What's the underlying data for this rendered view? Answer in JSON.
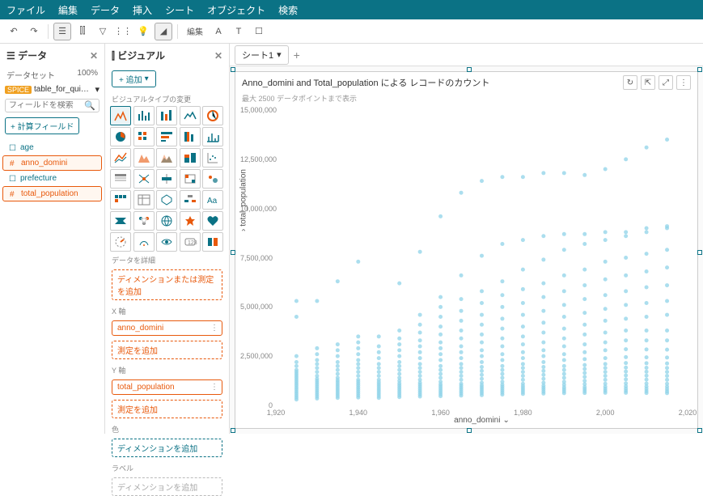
{
  "menu": {
    "items": [
      "ファイル",
      "編集",
      "データ",
      "挿入",
      "シート",
      "オブジェクト",
      "検索"
    ]
  },
  "toolbar": {
    "icons": [
      "undo",
      "redo",
      "autosave",
      "chart",
      "filter",
      "params",
      "insight",
      "highlight",
      "edit",
      "text",
      "ruler"
    ]
  },
  "data_panel": {
    "title": "データ",
    "subtitle": "データセット",
    "pct": "100%",
    "spice": "SPICE",
    "dataset": "table_for_quicksig...",
    "search_placeholder": "フィールドを検索",
    "calc_btn": "+ 計算フィールド",
    "fields": [
      {
        "name": "age",
        "type": "dim",
        "selected": false
      },
      {
        "name": "anno_domini",
        "type": "meas",
        "selected": true
      },
      {
        "name": "prefecture",
        "type": "dim",
        "selected": false
      },
      {
        "name": "total_population",
        "type": "meas",
        "selected": true
      }
    ]
  },
  "visual_panel": {
    "title": "ビジュアル",
    "add_btn": "+ 追加",
    "type_label": "ビジュアルタイプの変更",
    "types_count": 35,
    "selected_type": 0,
    "drill_label": "データを詳細",
    "drill_well": "ディメンションまたは測定を追加",
    "x_label": "X 軸",
    "x_well": "anno_domini",
    "x_add": "測定を追加",
    "y_label": "Y 軸",
    "y_well": "total_population",
    "y_add": "測定を追加",
    "color_label": "色",
    "color_well": "ディメンションを追加",
    "label_label": "ラベル",
    "label_well": "ディメンションを追加"
  },
  "canvas": {
    "tab": "シート1",
    "chart_title": "Anno_domini and Total_population による レコードのカウント",
    "chart_sub": "最大 2500 データポイントまで表示",
    "ylabel": "total_population",
    "xlabel": "anno_domini"
  },
  "chart_data": {
    "type": "scatter",
    "xlabel": "anno_domini",
    "ylabel": "total_population",
    "xlim": [
      1920,
      2020
    ],
    "ylim": [
      0,
      15000000
    ],
    "xticks": [
      1920,
      1940,
      1960,
      1980,
      2000,
      2020
    ],
    "yticks": [
      0,
      2500000,
      5000000,
      7500000,
      10000000,
      12500000,
      15000000
    ],
    "ytick_labels": [
      "0",
      "2,500,000",
      "5,000,000",
      "7,500,000",
      "10,000,000",
      "12,500,000",
      "15,000,000"
    ],
    "x_values": [
      1925,
      1930,
      1935,
      1940,
      1945,
      1950,
      1955,
      1960,
      1965,
      1970,
      1975,
      1980,
      1985,
      1990,
      1995,
      2000,
      2005,
      2010,
      2015
    ],
    "series_per_x": {
      "1925": [
        300000,
        400000,
        500000,
        600000,
        700000,
        800000,
        900000,
        1000000,
        1100000,
        1200000,
        1300000,
        1400000,
        1500000,
        1600000,
        1700000,
        1800000,
        2000000,
        2200000,
        2500000,
        4500000,
        5300000
      ],
      "1930": [
        350000,
        450000,
        550000,
        650000,
        750000,
        850000,
        950000,
        1050000,
        1150000,
        1250000,
        1350000,
        1500000,
        1700000,
        1900000,
        2100000,
        2300000,
        2600000,
        2900000,
        5300000
      ],
      "1935": [
        380000,
        480000,
        580000,
        680000,
        780000,
        880000,
        980000,
        1080000,
        1180000,
        1280000,
        1400000,
        1600000,
        1800000,
        2000000,
        2200000,
        2500000,
        2800000,
        3100000,
        6300000
      ],
      "1940": [
        400000,
        500000,
        600000,
        700000,
        800000,
        900000,
        1000000,
        1100000,
        1200000,
        1300000,
        1500000,
        1700000,
        1900000,
        2100000,
        2300000,
        2600000,
        2900000,
        3200000,
        3500000,
        7300000
      ],
      "1945": [
        380000,
        480000,
        580000,
        680000,
        780000,
        880000,
        980000,
        1080000,
        1180000,
        1300000,
        1500000,
        1700000,
        1900000,
        2100000,
        2400000,
        2700000,
        3000000,
        3500000
      ],
      "1950": [
        420000,
        520000,
        620000,
        720000,
        820000,
        920000,
        1020000,
        1120000,
        1250000,
        1400000,
        1600000,
        1800000,
        2000000,
        2200000,
        2500000,
        2800000,
        3100000,
        3400000,
        3800000,
        6200000
      ],
      "1955": [
        450000,
        550000,
        650000,
        750000,
        850000,
        950000,
        1050000,
        1150000,
        1300000,
        1500000,
        1700000,
        1900000,
        2100000,
        2400000,
        2700000,
        3000000,
        3300000,
        3700000,
        4100000,
        4600000,
        7800000
      ],
      "1960": [
        470000,
        570000,
        670000,
        770000,
        870000,
        970000,
        1070000,
        1200000,
        1400000,
        1600000,
        1800000,
        2000000,
        2300000,
        2600000,
        2900000,
        3200000,
        3600000,
        4000000,
        4500000,
        5000000,
        5500000,
        9600000
      ],
      "1965": [
        500000,
        600000,
        700000,
        800000,
        900000,
        1000000,
        1100000,
        1300000,
        1500000,
        1700000,
        1900000,
        2100000,
        2400000,
        2700000,
        3000000,
        3400000,
        3800000,
        4300000,
        4800000,
        5400000,
        6600000,
        10800000
      ],
      "1970": [
        520000,
        620000,
        720000,
        820000,
        920000,
        1020000,
        1150000,
        1350000,
        1550000,
        1750000,
        1950000,
        2200000,
        2500000,
        2800000,
        3200000,
        3600000,
        4100000,
        4600000,
        5200000,
        5800000,
        7600000,
        11400000
      ],
      "1975": [
        550000,
        650000,
        750000,
        850000,
        950000,
        1050000,
        1200000,
        1400000,
        1600000,
        1800000,
        2000000,
        2300000,
        2600000,
        3000000,
        3400000,
        3900000,
        4400000,
        5000000,
        5600000,
        6300000,
        8200000,
        11600000
      ],
      "1980": [
        580000,
        680000,
        780000,
        880000,
        980000,
        1100000,
        1300000,
        1500000,
        1700000,
        1900000,
        2100000,
        2400000,
        2700000,
        3100000,
        3500000,
        4000000,
        4600000,
        5200000,
        5900000,
        6900000,
        8400000,
        11600000
      ],
      "1985": [
        600000,
        700000,
        800000,
        900000,
        1000000,
        1150000,
        1350000,
        1550000,
        1750000,
        1950000,
        2200000,
        2500000,
        2800000,
        3200000,
        3700000,
        4200000,
        4800000,
        5500000,
        6200000,
        7400000,
        8600000,
        11800000
      ],
      "1990": [
        620000,
        720000,
        820000,
        920000,
        1050000,
        1200000,
        1400000,
        1600000,
        1800000,
        2000000,
        2300000,
        2600000,
        3000000,
        3400000,
        3900000,
        4500000,
        5100000,
        5800000,
        6600000,
        7900000,
        8700000,
        11800000
      ],
      "1995": [
        630000,
        730000,
        830000,
        930000,
        1080000,
        1250000,
        1450000,
        1650000,
        1850000,
        2050000,
        2350000,
        2700000,
        3100000,
        3600000,
        4100000,
        4700000,
        5400000,
        6100000,
        6900000,
        8200000,
        8700000,
        11700000
      ],
      "2000": [
        640000,
        740000,
        840000,
        950000,
        1100000,
        1300000,
        1500000,
        1700000,
        1900000,
        2100000,
        2400000,
        2800000,
        3200000,
        3700000,
        4300000,
        4900000,
        5600000,
        6400000,
        7300000,
        8400000,
        8800000,
        12000000
      ],
      "2005": [
        640000,
        740000,
        850000,
        970000,
        1120000,
        1320000,
        1520000,
        1720000,
        1920000,
        2150000,
        2450000,
        2850000,
        3300000,
        3800000,
        4400000,
        5100000,
        5800000,
        6600000,
        7500000,
        8600000,
        8800000,
        12500000
      ],
      "2010": [
        630000,
        730000,
        840000,
        960000,
        1110000,
        1310000,
        1510000,
        1710000,
        1910000,
        2140000,
        2440000,
        2840000,
        3300000,
        3800000,
        4500000,
        5200000,
        6000000,
        6800000,
        7700000,
        8800000,
        9000000,
        13100000
      ],
      "2015": [
        620000,
        720000,
        830000,
        950000,
        1100000,
        1300000,
        1500000,
        1700000,
        1900000,
        2130000,
        2430000,
        2830000,
        3300000,
        3800000,
        4600000,
        5300000,
        6100000,
        7000000,
        7900000,
        9000000,
        9100000,
        13500000
      ]
    }
  }
}
